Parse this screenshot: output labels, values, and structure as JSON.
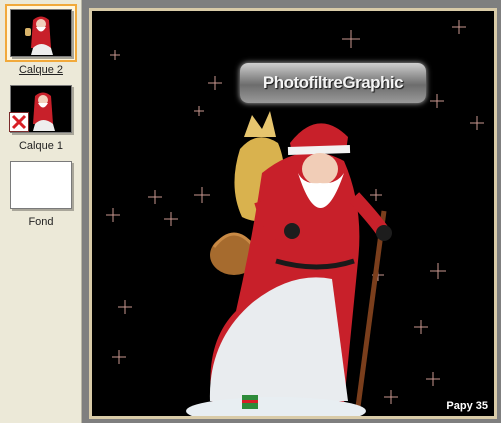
{
  "layers_panel": {
    "layers": [
      {
        "label": "Calque 2",
        "selected": true,
        "visible": true
      },
      {
        "label": "Calque 1",
        "selected": false,
        "visible": false
      },
      {
        "label": "Fond",
        "selected": false,
        "visible": true
      }
    ]
  },
  "canvas": {
    "watermark": "PhotofiltreGraphic",
    "signature": "Papy 35"
  },
  "colors": {
    "panel_bg": "#ece9d8",
    "workspace_bg": "#7f7f7f",
    "selection_accent": "#f1a93b",
    "canvas_frame": "#d9cba8",
    "santa_red": "#c8202a"
  },
  "icons": {
    "hidden_layer": "red-x-icon"
  }
}
